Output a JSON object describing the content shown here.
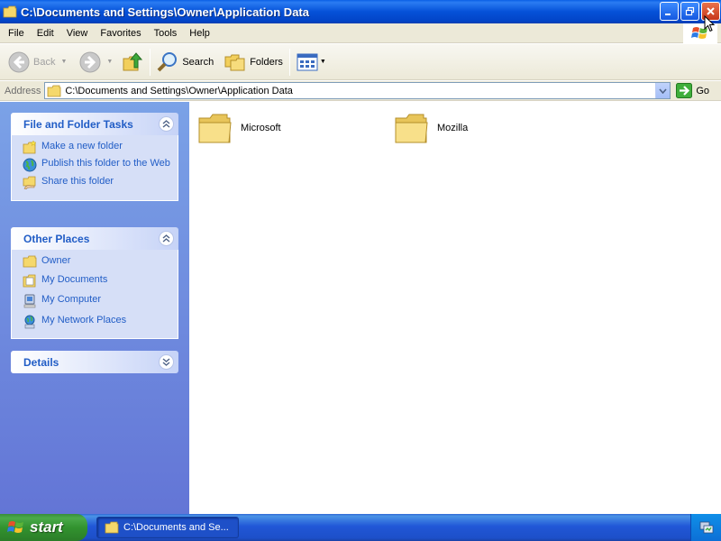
{
  "window": {
    "title": "C:\\Documents and Settings\\Owner\\Application Data"
  },
  "menu": [
    "File",
    "Edit",
    "View",
    "Favorites",
    "Tools",
    "Help"
  ],
  "toolbar": {
    "back_label": "Back",
    "search_label": "Search",
    "folders_label": "Folders"
  },
  "address": {
    "label": "Address",
    "value": "C:\\Documents and Settings\\Owner\\Application Data",
    "go_label": "Go"
  },
  "sidebar": {
    "file_tasks": {
      "title": "File and Folder Tasks",
      "items": [
        "Make a new folder",
        "Publish this folder to the Web",
        "Share this folder"
      ]
    },
    "other_places": {
      "title": "Other Places",
      "items": [
        "Owner",
        "My Documents",
        "My Computer",
        "My Network Places"
      ]
    },
    "details": {
      "title": "Details"
    }
  },
  "content": {
    "items": [
      "Microsoft",
      "Mozilla"
    ]
  },
  "taskbar": {
    "start_label": "start",
    "task_label": "C:\\Documents and Se..."
  },
  "colors": {
    "titlebar": "#0551d8",
    "sidebar_link": "#215dc6",
    "start_green": "#32932f"
  }
}
